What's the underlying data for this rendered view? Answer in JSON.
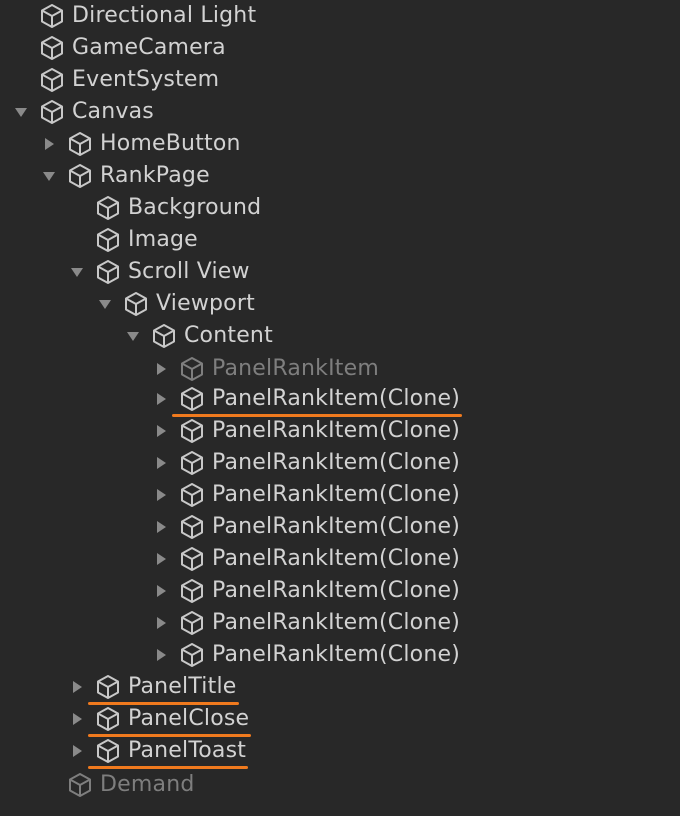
{
  "colors": {
    "background": "#282828",
    "text": "#d2d2d2",
    "text_inactive": "#7e7e7e",
    "icon": "#c8c8c8",
    "arrow": "#8a8a8a",
    "highlight": "#f07a1e"
  },
  "icons": {
    "object": "cube-icon",
    "collapsed": "triangle-right-icon",
    "expanded": "triangle-down-icon"
  },
  "hierarchy": [
    {
      "label": "Directional Light",
      "depth": 0,
      "arrow": "none",
      "active": true
    },
    {
      "label": "GameCamera",
      "depth": 0,
      "arrow": "none",
      "active": true
    },
    {
      "label": "EventSystem",
      "depth": 0,
      "arrow": "none",
      "active": true
    },
    {
      "label": "Canvas",
      "depth": 0,
      "arrow": "expanded",
      "active": true
    },
    {
      "label": "HomeButton",
      "depth": 1,
      "arrow": "collapsed",
      "active": true
    },
    {
      "label": "RankPage",
      "depth": 1,
      "arrow": "expanded",
      "active": true
    },
    {
      "label": "Background",
      "depth": 2,
      "arrow": "none",
      "active": true
    },
    {
      "label": "Image",
      "depth": 2,
      "arrow": "none",
      "active": true
    },
    {
      "label": "Scroll View",
      "depth": 2,
      "arrow": "expanded",
      "active": true
    },
    {
      "label": "Viewport",
      "depth": 3,
      "arrow": "expanded",
      "active": true
    },
    {
      "label": "Content",
      "depth": 4,
      "arrow": "expanded",
      "active": true
    },
    {
      "label": "PanelRankItem",
      "depth": 5,
      "arrow": "collapsed",
      "active": false
    },
    {
      "label": "PanelRankItem(Clone)",
      "depth": 5,
      "arrow": "collapsed",
      "active": true,
      "highlighted": true
    },
    {
      "label": "PanelRankItem(Clone)",
      "depth": 5,
      "arrow": "collapsed",
      "active": true
    },
    {
      "label": "PanelRankItem(Clone)",
      "depth": 5,
      "arrow": "collapsed",
      "active": true
    },
    {
      "label": "PanelRankItem(Clone)",
      "depth": 5,
      "arrow": "collapsed",
      "active": true
    },
    {
      "label": "PanelRankItem(Clone)",
      "depth": 5,
      "arrow": "collapsed",
      "active": true
    },
    {
      "label": "PanelRankItem(Clone)",
      "depth": 5,
      "arrow": "collapsed",
      "active": true
    },
    {
      "label": "PanelRankItem(Clone)",
      "depth": 5,
      "arrow": "collapsed",
      "active": true
    },
    {
      "label": "PanelRankItem(Clone)",
      "depth": 5,
      "arrow": "collapsed",
      "active": true
    },
    {
      "label": "PanelRankItem(Clone)",
      "depth": 5,
      "arrow": "collapsed",
      "active": true
    },
    {
      "label": "PanelTitle",
      "depth": 2,
      "arrow": "collapsed",
      "active": true,
      "highlighted": true
    },
    {
      "label": "PanelClose",
      "depth": 2,
      "arrow": "collapsed",
      "active": true,
      "highlighted": true
    },
    {
      "label": "PanelToast",
      "depth": 2,
      "arrow": "collapsed",
      "active": true,
      "highlighted": true
    },
    {
      "label": "Demand",
      "depth": 1,
      "arrow": "none",
      "active": false
    }
  ]
}
